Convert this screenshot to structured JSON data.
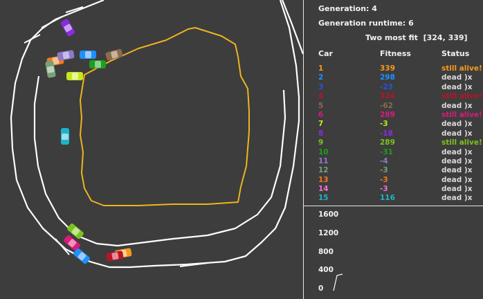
{
  "header": {
    "generation_label": "Generation:",
    "generation": "4",
    "runtime_label": "Generation runtime:",
    "runtime": "6",
    "most_fit_label": "Two most fit",
    "most_fit": "[324, 339]"
  },
  "table": {
    "headers": [
      "Car",
      "Fitness",
      "Status"
    ],
    "rows": [
      {
        "car": "1",
        "fitness": "339",
        "status": "still alive!",
        "color": "#f59a1e",
        "status_color": "#f59a1e"
      },
      {
        "car": "2",
        "fitness": "298",
        "status": "dead )x",
        "color": "#1e90ff",
        "status_color": "#d8d8d8"
      },
      {
        "car": "3",
        "fitness": "-23",
        "status": "dead )x",
        "color": "#2a52d8",
        "status_color": "#d8d8d8"
      },
      {
        "car": "4",
        "fitness": "324",
        "status": "still alive!",
        "color": "#b81428",
        "status_color": "#b81428"
      },
      {
        "car": "5",
        "fitness": "-62",
        "status": "dead )x",
        "color": "#8b6a4e",
        "status_color": "#d8d8d8"
      },
      {
        "car": "6",
        "fitness": "289",
        "status": "still alive!",
        "color": "#d81c78",
        "status_color": "#d81c78"
      },
      {
        "car": "7",
        "fitness": "-3",
        "status": "dead )x",
        "color": "#c8e61e",
        "status_color": "#d8d8d8"
      },
      {
        "car": "8",
        "fitness": "-18",
        "status": "dead )x",
        "color": "#8a2be2",
        "status_color": "#d8d8d8"
      },
      {
        "car": "9",
        "fitness": "289",
        "status": "still alive!",
        "color": "#7cc21e",
        "status_color": "#7cc21e"
      },
      {
        "car": "10",
        "fitness": "-31",
        "status": "dead )x",
        "color": "#1e9e1e",
        "status_color": "#d8d8d8"
      },
      {
        "car": "11",
        "fitness": "-4",
        "status": "dead )x",
        "color": "#8c7ac8",
        "status_color": "#d8d8d8"
      },
      {
        "car": "12",
        "fitness": "-3",
        "status": "dead )x",
        "color": "#78a078",
        "status_color": "#d8d8d8"
      },
      {
        "car": "13",
        "fitness": "-3",
        "status": "dead )x",
        "color": "#f0781e",
        "status_color": "#d8d8d8"
      },
      {
        "car": "14",
        "fitness": "-3",
        "status": "dead )x",
        "color": "#f070d0",
        "status_color": "#d8d8d8"
      },
      {
        "car": "15",
        "fitness": "116",
        "status": "dead )x",
        "color": "#1eb4c8",
        "status_color": "#d8d8d8"
      }
    ]
  },
  "graph": {
    "y_ticks": [
      "1600",
      "1200",
      "800",
      "400",
      "0"
    ]
  },
  "colors": {
    "background": "#3d3d3d",
    "track": "#ffffff",
    "best_path": "#f0b41e",
    "text": "#f2f2f2"
  }
}
